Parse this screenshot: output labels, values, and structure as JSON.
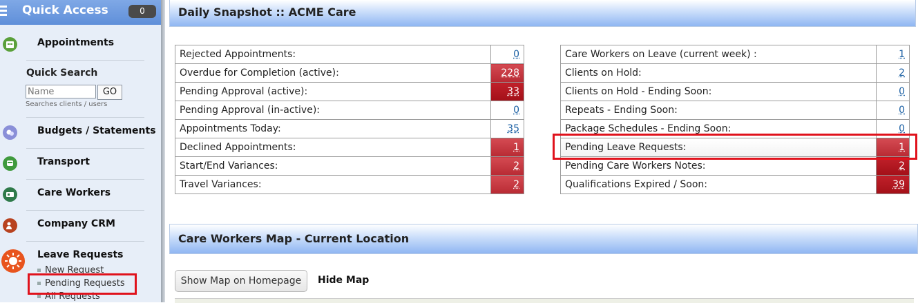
{
  "sidebar": {
    "title": "Quick Access",
    "badge": "0",
    "appointments": "Appointments",
    "quick_search": {
      "title": "Quick Search",
      "placeholder": "Name",
      "go": "GO",
      "hint": "Searches clients / users"
    },
    "items": [
      {
        "label": "Budgets / Statements",
        "icon": "budget-icon",
        "color": "#8a8fd8"
      },
      {
        "label": "Transport",
        "icon": "bus-icon",
        "color": "#3f9a3d"
      },
      {
        "label": "Care Workers",
        "icon": "id-card-icon",
        "color": "#2f7a4a"
      },
      {
        "label": "Company CRM",
        "icon": "crm-icon",
        "color": "#b8421f"
      }
    ],
    "leave": {
      "label": "Leave Requests",
      "sub": [
        "New Request",
        "Pending Requests",
        "All Requests"
      ]
    }
  },
  "snapshot": {
    "title": "Daily Snapshot :: ACME Care",
    "left": [
      {
        "label": "Rejected Appointments:",
        "value": "0"
      },
      {
        "label": "Overdue for Completion (active):",
        "value": "228"
      },
      {
        "label": "Pending Approval (active):",
        "value": "33"
      },
      {
        "label": "Pending Approval (in-active):",
        "value": "0"
      },
      {
        "label": "Appointments Today:",
        "value": "35"
      },
      {
        "label": "Declined Appointments:",
        "value": "1"
      },
      {
        "label": "Start/End Variances:",
        "value": "2"
      },
      {
        "label": "Travel Variances:",
        "value": "2"
      }
    ],
    "right": [
      {
        "label": "Care Workers on Leave (current week) :",
        "value": "1"
      },
      {
        "label": "Clients on Hold:",
        "value": "2"
      },
      {
        "label": "Clients on Hold - Ending Soon:",
        "value": "0"
      },
      {
        "label": "Repeats - Ending Soon:",
        "value": "0"
      },
      {
        "label": "Package Schedules - Ending Soon:",
        "value": "0"
      },
      {
        "label": "Pending Leave Requests:",
        "value": "1"
      },
      {
        "label": "Pending Care Workers Notes:",
        "value": "2"
      },
      {
        "label": "Qualifications Expired / Soon:",
        "value": "39"
      }
    ]
  },
  "map": {
    "title": "Care Workers Map - Current Location",
    "show_button": "Show Map on Homepage",
    "hide_link": "Hide Map"
  }
}
